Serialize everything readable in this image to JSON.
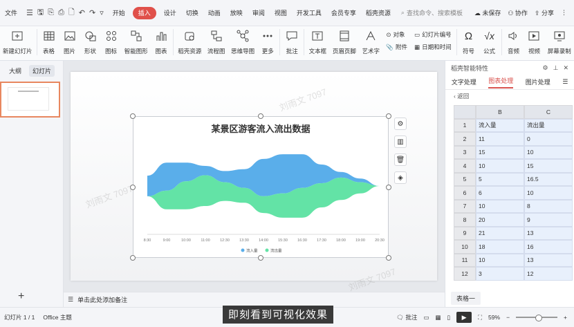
{
  "menubar": {
    "file": "文件",
    "tabs": [
      {
        "label": "开始",
        "active": false
      },
      {
        "label": "插入",
        "active": true
      },
      {
        "label": "设计",
        "active": false
      },
      {
        "label": "切换",
        "active": false
      },
      {
        "label": "动画",
        "active": false
      },
      {
        "label": "放映",
        "active": false
      },
      {
        "label": "审阅",
        "active": false
      },
      {
        "label": "视图",
        "active": false
      },
      {
        "label": "开发工具",
        "active": false
      },
      {
        "label": "会员专享",
        "active": false
      },
      {
        "label": "稻壳资源",
        "active": false
      }
    ],
    "search_placeholder": "查找命令、搜索模板",
    "unsaved": "未保存",
    "collab": "协作",
    "share": "分享"
  },
  "ribbon": {
    "new_slide": "新建幻灯片",
    "table": "表格",
    "picture": "图片",
    "shape": "形状",
    "icon": "图标",
    "smart_graphic": "智能图形",
    "chart": "图表",
    "docer_material": "稻壳资源",
    "flowchart": "流程图",
    "mindmap": "思维导图",
    "more": "更多",
    "comment": "批注",
    "textbox": "文本框",
    "header_footer": "页眉页脚",
    "wordart": "艺术字",
    "object": "对象",
    "slide_number": "幻灯片编号",
    "attachment": "附件",
    "datetime": "日期和时间",
    "symbol": "符号",
    "formula": "公式",
    "audio": "音频",
    "video": "视频",
    "screen_record": "屏幕录制"
  },
  "leftpanel": {
    "outline_tab": "大纲",
    "slides_tab": "幻灯片"
  },
  "notes_placeholder": "单击此处添加备注",
  "watermark": "刘雨文 7097",
  "rightpanel": {
    "title": "稻壳智能特性",
    "tabs": [
      {
        "label": "文字处理",
        "active": false
      },
      {
        "label": "图表处理",
        "active": true
      },
      {
        "label": "图片处理",
        "active": false
      }
    ],
    "back": "返回",
    "col_b": "B",
    "col_c": "C",
    "rows": [
      {
        "n": "1",
        "b": "流入量",
        "c": "流出量"
      },
      {
        "n": "2",
        "b": "11",
        "c": "0"
      },
      {
        "n": "3",
        "b": "15",
        "c": "10"
      },
      {
        "n": "4",
        "b": "10",
        "c": "15"
      },
      {
        "n": "5",
        "b": "5",
        "c": "16.5"
      },
      {
        "n": "6",
        "b": "6",
        "c": "10"
      },
      {
        "n": "7",
        "b": "10",
        "c": "8"
      },
      {
        "n": "8",
        "b": "20",
        "c": "9"
      },
      {
        "n": "9",
        "b": "21",
        "c": "13"
      },
      {
        "n": "10",
        "b": "18",
        "c": "16"
      },
      {
        "n": "11",
        "b": "10",
        "c": "13"
      },
      {
        "n": "12",
        "b": "3",
        "c": "12"
      }
    ],
    "sheet_tab": "表格一"
  },
  "statusbar": {
    "slide_count": "幻灯片 1 / 1",
    "theme": "Office 主题",
    "comment": "批注",
    "zoom": "59%"
  },
  "subtitle": "即刻看到可视化效果",
  "colors": {
    "inflow": "#5aaeea",
    "outflow": "#63e3a6",
    "accent": "#e0504a"
  },
  "chart_data": {
    "type": "area",
    "title": "某景区游客流入流出数据",
    "x": [
      "8:30",
      "9:00",
      "10:00",
      "11:00",
      "12:30",
      "13:30",
      "14:00",
      "15:30",
      "16:30",
      "17:30",
      "18:00",
      "19:00",
      "20:30"
    ],
    "series": [
      {
        "name": "流入量",
        "values": [
          11,
          15,
          10,
          5,
          6,
          10,
          20,
          21,
          18,
          10,
          3,
          2,
          0
        ]
      },
      {
        "name": "流出量",
        "values": [
          0,
          10,
          15,
          16.5,
          10,
          8,
          9,
          13,
          16,
          13,
          12,
          6,
          0
        ]
      }
    ],
    "layout": "streamgraph",
    "legend": "bottom"
  }
}
